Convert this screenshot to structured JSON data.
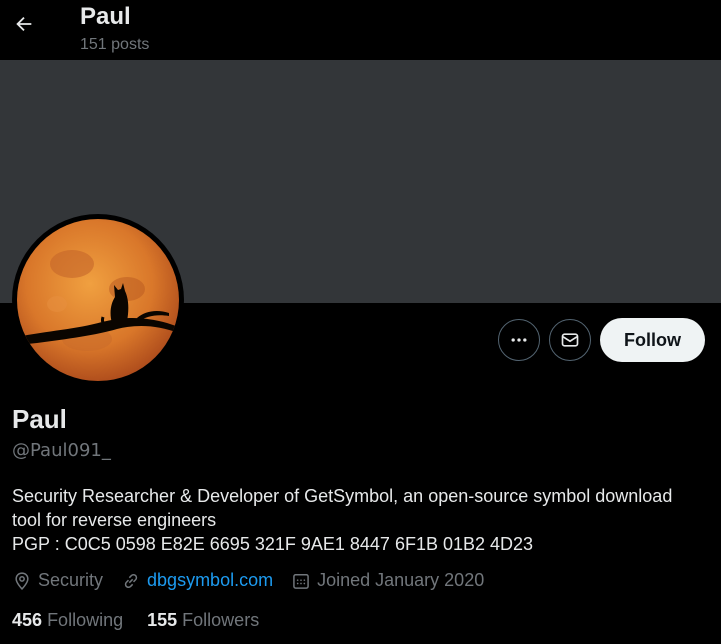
{
  "header": {
    "name": "Paul",
    "posts": "151 posts"
  },
  "profile": {
    "name": "Paul",
    "handle": "@Paul091_",
    "bio_lines": [
      "Security Researcher & Developer of GetSymbol, an open-source symbol download",
      "tool for reverse engineers",
      "PGP : C0C5 0598 E82E 6695 321F 9AE1 8447 6F1B 01B2 4D23"
    ],
    "location": "Security",
    "website": "dbgsymbol.com",
    "joined": "Joined January 2020"
  },
  "actions": {
    "follow_label": "Follow"
  },
  "stats": {
    "following_count": "456",
    "following_label": "Following",
    "followers_count": "155",
    "followers_label": "Followers"
  },
  "colors": {
    "background": "#000000",
    "banner": "#333639",
    "muted": "#71767b",
    "link": "#1d9bf0",
    "follow_bg": "#eff3f4",
    "moon": "#d9772a"
  },
  "icons": [
    "back-arrow-icon",
    "more-icon",
    "mail-icon",
    "location-icon",
    "link-icon",
    "calendar-icon"
  ]
}
